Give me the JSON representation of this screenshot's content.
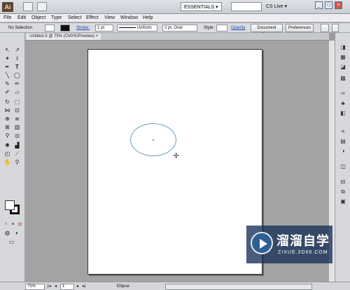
{
  "title_bar": {
    "app_icon": "Ai",
    "workspace": "ESSENTIALS",
    "workspace_arrow": "▾",
    "cs_live": "CS Live",
    "cs_live_arrow": "▾",
    "minimize": "_",
    "maximize": "□",
    "close": "×"
  },
  "menu": [
    "File",
    "Edit",
    "Object",
    "Type",
    "Select",
    "Effect",
    "View",
    "Window",
    "Help"
  ],
  "control_bar": {
    "selection": "No Selection",
    "stroke_label": "Stroke:",
    "stroke_weight": "1 pt",
    "profile": "Uniform",
    "brush": "2 pt. Oval",
    "style_label": "Style:",
    "opacity_label": "Opacity",
    "document_setup": "Document Setup",
    "preferences": "Preferences"
  },
  "document": {
    "tab_title": "Untitled-5 @ 75% (CMYK/Preview)",
    "tab_close": "×"
  },
  "status_bar": {
    "zoom": "75%",
    "page": "1",
    "tool": "Ellipse"
  },
  "watermark": {
    "title": "溜溜自学",
    "url": "ZIXUE.3D66.COM"
  },
  "colors": {
    "ellipse_stroke": "#6f9fb9",
    "fill": "#ffffff",
    "stroke": "#111111"
  }
}
